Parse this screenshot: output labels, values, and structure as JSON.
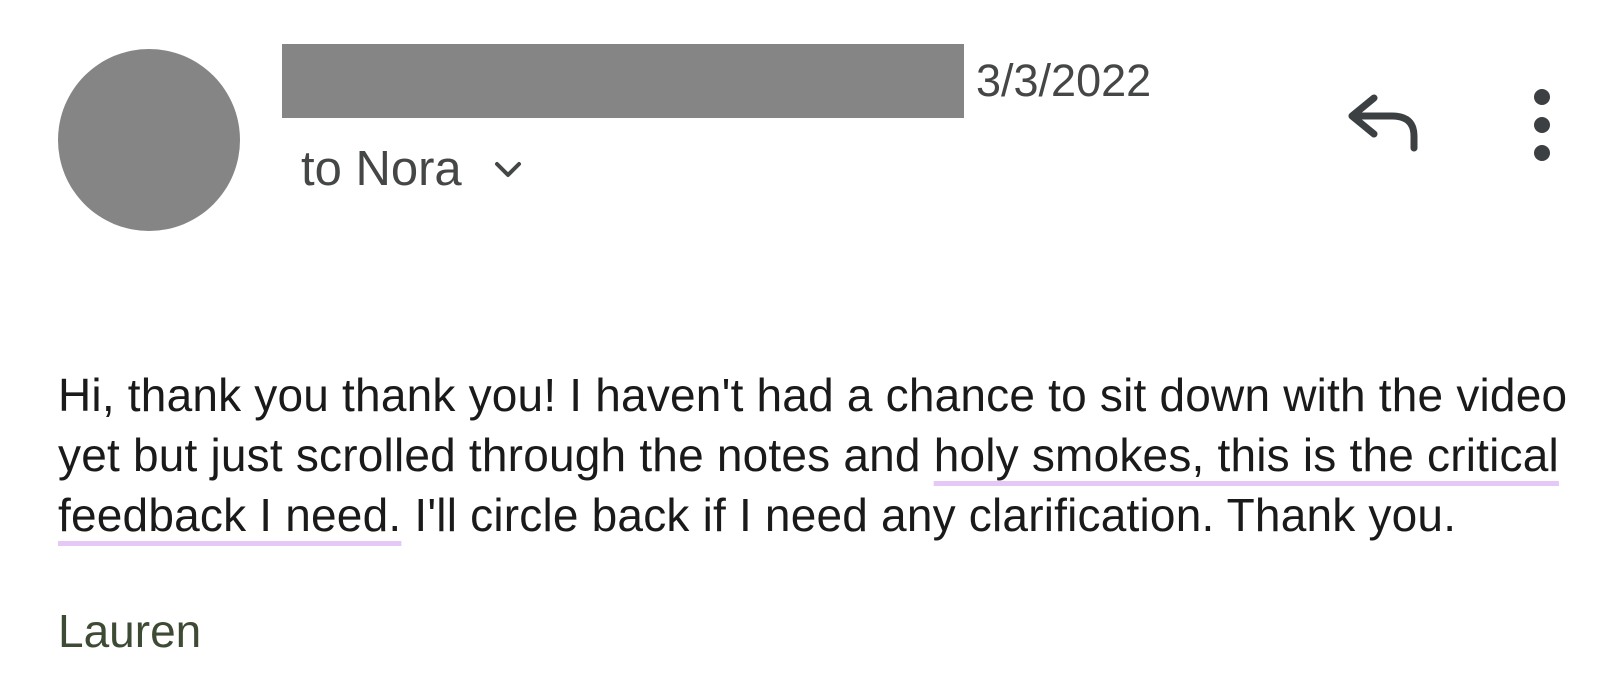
{
  "header": {
    "date": "3/3/2022",
    "recipient_label": "to Nora"
  },
  "icons": {
    "avatar": "avatar",
    "recipient_details": "chevron-down-icon",
    "reply": "reply-icon",
    "more": "more-vert-icon"
  },
  "message": {
    "text_before": "Hi, thank you thank you! I haven't had a chance to sit down with the video yet but just scrolled through the notes and ",
    "highlighted_text": "holy smokes, this is the critical feedback I need.",
    "text_after": " I'll circle back if I need any clarification. Thank you.",
    "signature": "Lauren",
    "highlight_color": "#e6c8f6"
  },
  "colors": {
    "avatar": "#858585",
    "redaction": "#858585",
    "secondary_text": "#444746",
    "signature_text": "#3d4a34"
  }
}
